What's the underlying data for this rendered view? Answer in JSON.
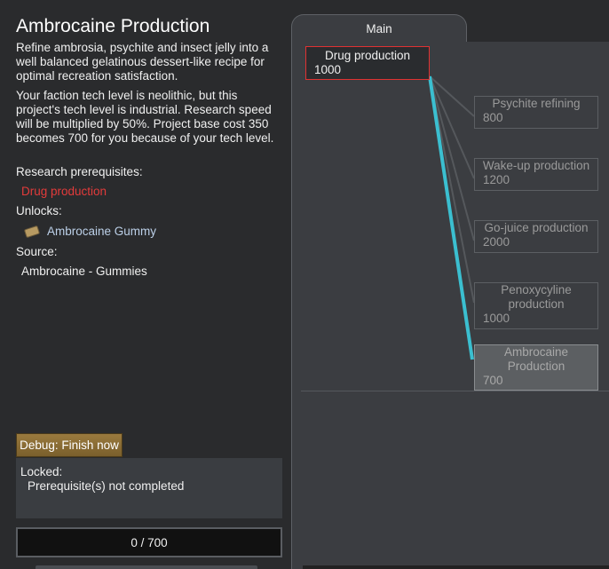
{
  "project": {
    "title": "Ambrocaine Production",
    "description": "Refine ambrosia, psychite and insect jelly into a well balanced gelatinous dessert-like recipe for optimal recreation satisfaction.",
    "tech_note": "Your faction tech level is neolithic, but this project's tech level is industrial. Research speed will be multiplied by 50%. Project base cost 350 becomes 700 for you because of your tech level.",
    "prereq_label": "Research prerequisites:",
    "prereq": "Drug production",
    "unlocks_label": "Unlocks:",
    "unlock_item": "Ambrocaine Gummy",
    "unlock_icon": "gummy-icon",
    "source_label": "Source:",
    "source": "Ambrocaine - Gummies"
  },
  "debug_button": "Debug: Finish now",
  "locked": {
    "title": "Locked:",
    "reason": "Prerequisite(s) not completed"
  },
  "progress": {
    "text": "0 / 700",
    "fraction": 0
  },
  "tabs": [
    "Main"
  ],
  "tree": {
    "root": {
      "name": "Drug production",
      "cost": "1000"
    },
    "children": [
      {
        "name": "Psychite refining",
        "cost": "800"
      },
      {
        "name": "Wake-up production",
        "cost": "1200"
      },
      {
        "name": "Go-juice production",
        "cost": "2000"
      },
      {
        "name": "Penoxycyline production",
        "cost": "1000"
      },
      {
        "name": "Ambrocaine Production",
        "cost": "700"
      }
    ]
  },
  "colors": {
    "prereq_missing": "#e33b3b",
    "highlight_link": "#3bbfd0",
    "unlock_link": "#bcd0e8",
    "debug_button": "#8a6c35"
  }
}
